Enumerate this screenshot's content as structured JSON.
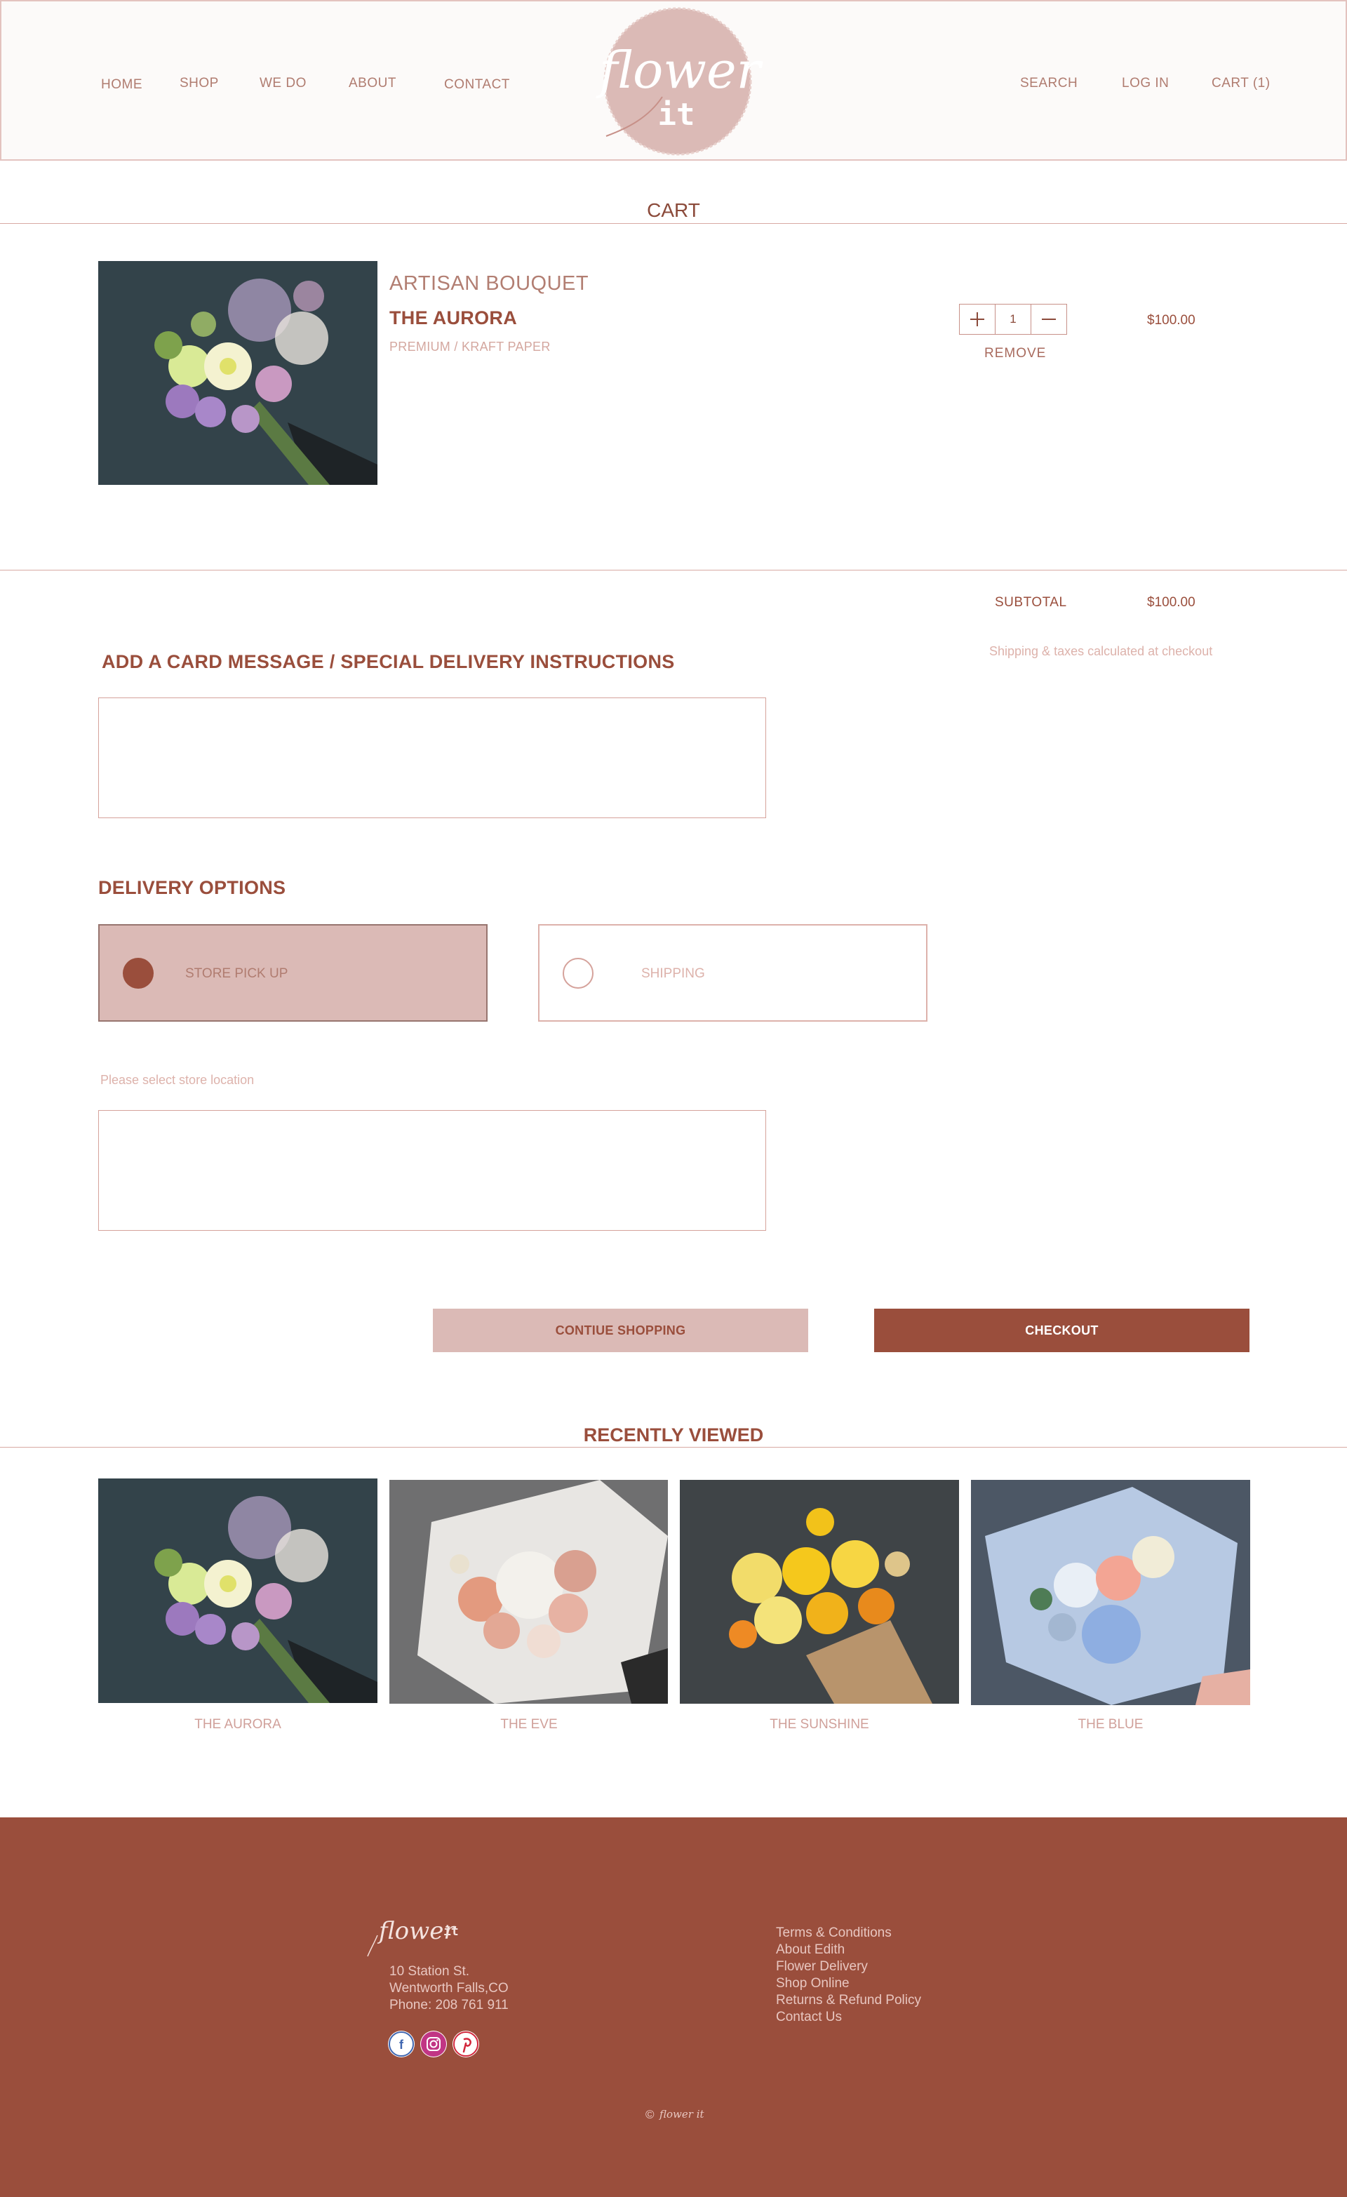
{
  "nav": {
    "left": [
      "HOME",
      "SHOP",
      "WE DO",
      "ABOUT",
      "CONTACT"
    ],
    "right": [
      "SEARCH",
      "LOG IN",
      "CART (1)"
    ],
    "logo_top": "flower",
    "logo_bottom": "it"
  },
  "cart": {
    "title": "CART",
    "item": {
      "category": "ARTISAN BOUQUET",
      "name": "THE AURORA",
      "option": "PREMIUM / KRAFT PAPER",
      "quantity": "1",
      "remove_label": "REMOVE",
      "price": "$100.00"
    },
    "subtotal_label": "SUBTOTAL",
    "subtotal_value": "$100.00",
    "shipping_note": "Shipping & taxes calculated at checkout"
  },
  "message": {
    "heading": "ADD A CARD MESSAGE / SPECIAL DELIVERY INSTRUCTIONS",
    "value": ""
  },
  "delivery": {
    "heading": "DELIVERY OPTIONS",
    "options": [
      "STORE PICK UP",
      "SHIPPING"
    ],
    "selected": "STORE PICK UP",
    "store_note": "Please select store location",
    "store_value": ""
  },
  "actions": {
    "continue_label": "CONTIUE SHOPPING",
    "checkout_label": "CHECKOUT"
  },
  "recently_viewed": {
    "title": "RECENTLY VIEWED",
    "items": [
      "THE AURORA",
      "THE EVE",
      "THE SUNSHINE",
      "THE BLUE"
    ]
  },
  "footer": {
    "logo_text": "flower",
    "logo_it": "it",
    "address": [
      "10 Station St.",
      "Wentworth Falls,CO",
      "Phone: 208 761 911"
    ],
    "links": [
      "Terms & Conditions",
      "About Edith",
      "Flower Delivery",
      "Shop Online",
      "Returns & Refund Policy",
      "Contact Us"
    ],
    "social": [
      "facebook-icon",
      "instagram-icon",
      "pinterest-icon"
    ],
    "copyright_mark": "©",
    "copyright_brand": "flower it"
  },
  "colors": {
    "brand": "#9a4e3c",
    "blush": "#dbbab6",
    "muted_text": "#ddb2ab"
  }
}
